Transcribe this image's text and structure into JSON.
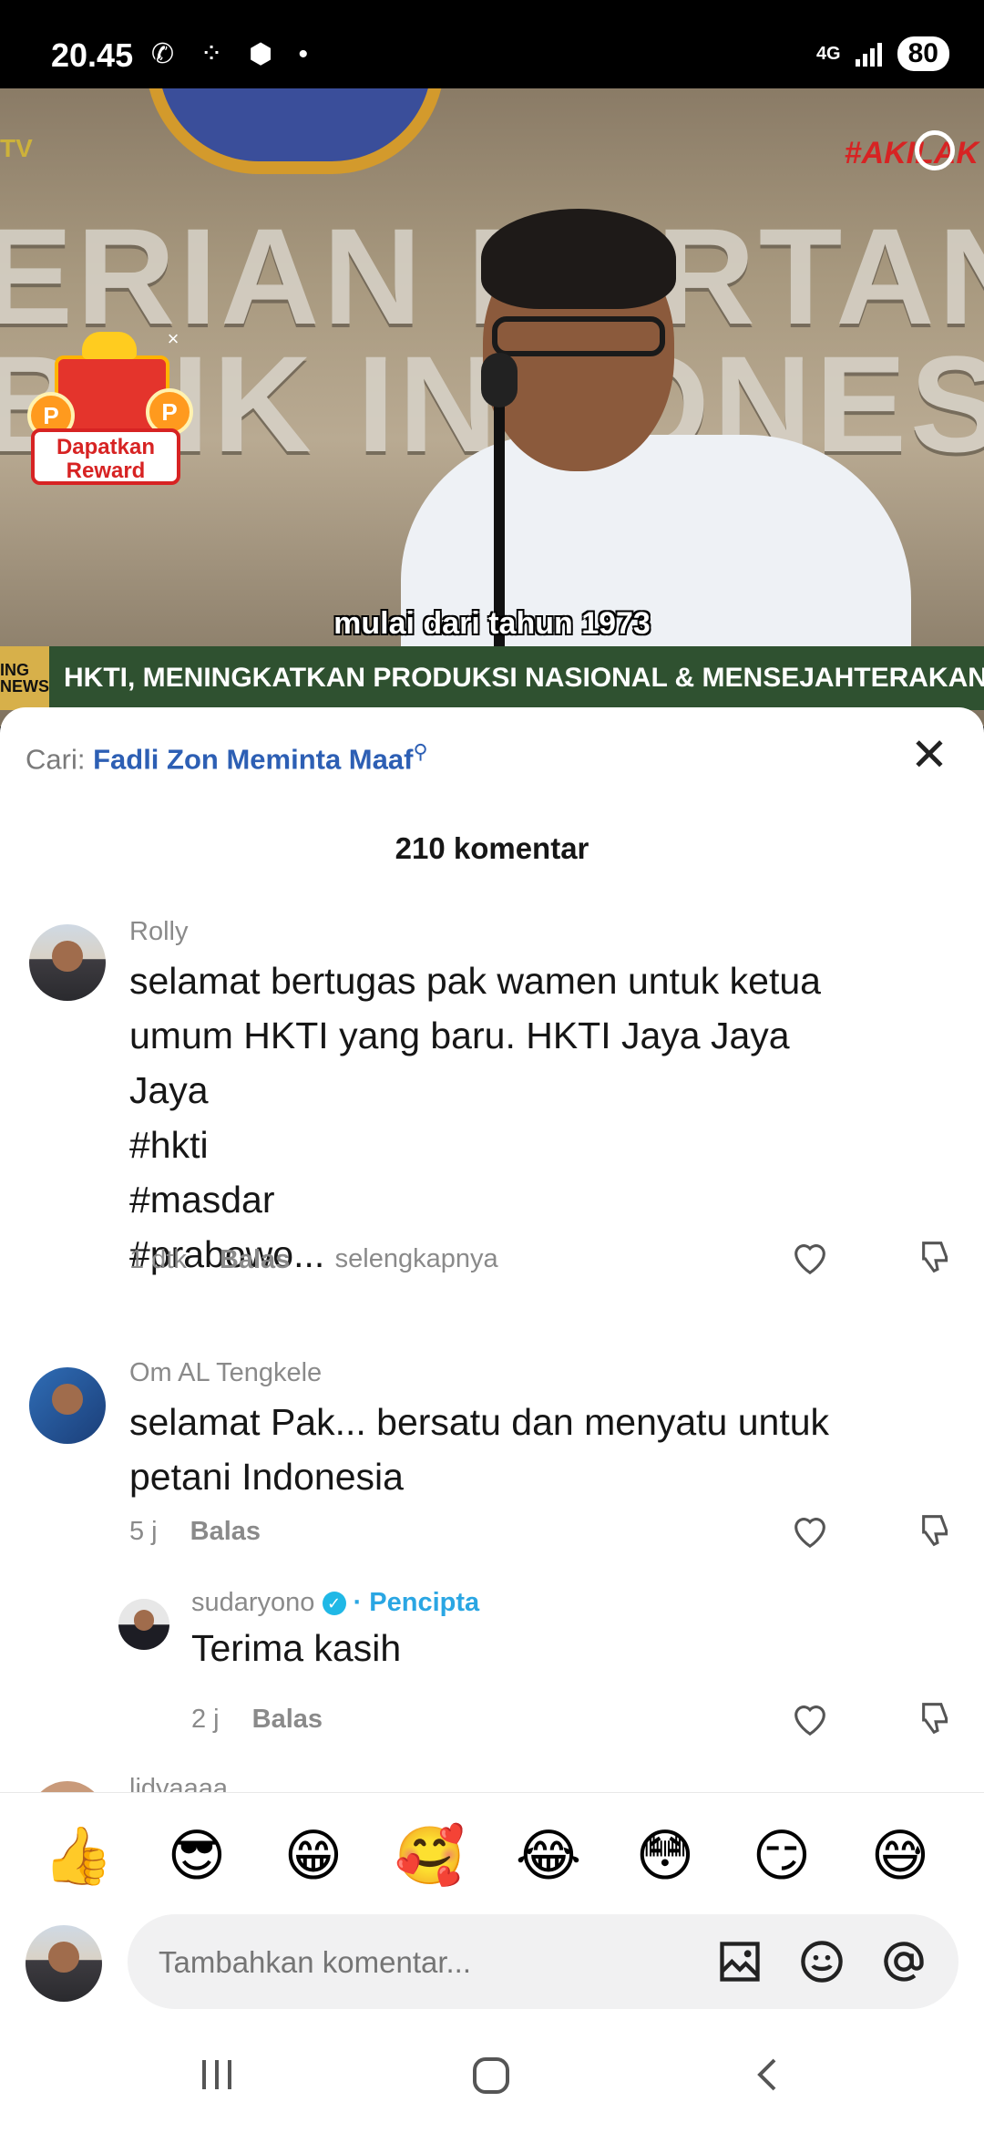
{
  "status_bar": {
    "time": "20.45",
    "left_icons": "✆ ⁘ ⬢ •",
    "network": "4G",
    "battery": "80"
  },
  "video": {
    "wall_line1": "ERIAN PERTANIAN",
    "wall_line2": "BLIK INDONESIA",
    "tv_logo": "TV",
    "corner_logo": "#AKILAK",
    "subtitle": "mulai dari tahun 1973",
    "ticker_badge_line1": "ING",
    "ticker_badge_line2": "NEWS",
    "ticker": "HKTI, MENINGKATKAN PRODUKSI NASIONAL & MENSEJAHTERAKAN PETANI"
  },
  "reward": {
    "line1": "Dapatkan",
    "line2": "Reward",
    "coin": "P",
    "close": "×"
  },
  "sheet": {
    "search_prefix": "Cari:",
    "search_query": "Fadli Zon Meminta Maaf",
    "close": "✕",
    "comment_count": "210 komentar"
  },
  "comments": [
    {
      "name": "Rolly",
      "text": "selamat bertugas pak wamen untuk ketua\numum HKTI yang baru. HKTI Jaya Jaya\nJaya\n#hkti\n#masdar\n#prabowo...",
      "more": "selengkapnya",
      "time": "1 dtk",
      "reply": "Balas"
    },
    {
      "name": "Om AL Tengkele",
      "text": "selamat Pak... bersatu dan menyatu untuk\npetani Indonesia",
      "time": "5 j",
      "reply": "Balas"
    },
    {
      "name": "sudaryono",
      "creator_label": "· Pencipta",
      "text": "Terima kasih",
      "time": "2 j",
      "reply": "Balas"
    },
    {
      "name": "lidyaaaa"
    }
  ],
  "emojis": [
    "👍",
    "😎",
    "😁",
    "🥰",
    "😂",
    "😳",
    "😏",
    "😅"
  ],
  "input": {
    "placeholder": "Tambahkan komentar..."
  },
  "icons": {
    "verified": "✓",
    "search_mini": "🔍"
  }
}
